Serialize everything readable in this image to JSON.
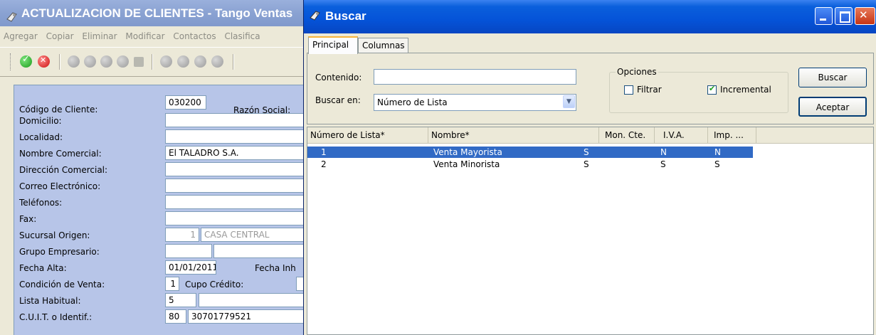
{
  "background_window": {
    "title": "ACTUALIZACION DE CLIENTES - Tango Ventas",
    "menu": [
      "Agregar",
      "Copiar",
      "Eliminar",
      "Modificar",
      "Contactos",
      "Clasifica"
    ],
    "fields": {
      "codigo_cliente": {
        "label": "Código de Cliente:",
        "value": "030200"
      },
      "razon_social": {
        "label": "Razón Social:"
      },
      "domicilio": {
        "label": "Domicilio:"
      },
      "localidad": {
        "label": "Localidad:"
      },
      "nombre_comercial": {
        "label": "Nombre Comercial:",
        "value": "El TALADRO S.A."
      },
      "direccion_comercial": {
        "label": "Dirección Comercial:"
      },
      "correo": {
        "label": "Correo Electrónico:"
      },
      "telefonos": {
        "label": "Teléfonos:"
      },
      "fax": {
        "label": "Fax:"
      },
      "sucursal_origen": {
        "label": "Sucursal Origen:",
        "code": "1",
        "name": "CASA CENTRAL"
      },
      "grupo_empresario": {
        "label": "Grupo Empresario:"
      },
      "fecha_alta": {
        "label": "Fecha Alta:",
        "value": "01/01/2011",
        "other_label": "Fecha Inh"
      },
      "condicion_venta": {
        "label": "Condición de Venta:",
        "value": "1",
        "cupo_label": "Cupo Crédito:"
      },
      "lista_habitual": {
        "label": "Lista Habitual:",
        "value": "5"
      },
      "cuit": {
        "label": "C.U.I.T. o Identif.:",
        "code": "80",
        "value": "30701779521"
      }
    }
  },
  "dialog": {
    "title": "Buscar",
    "tabs": [
      {
        "label": "Principal",
        "active": true
      },
      {
        "label": "Columnas",
        "active": false
      }
    ],
    "contenido_label": "Contenido:",
    "contenido_value": "",
    "buscar_en_label": "Buscar en:",
    "buscar_en_value": "Número de Lista",
    "opciones_label": "Opciones",
    "filtrar_label": "Filtrar",
    "filtrar_checked": false,
    "incremental_label": "Incremental",
    "incremental_checked": true,
    "buscar_button": "Buscar",
    "aceptar_button": "Aceptar",
    "grid": {
      "columns": [
        "Número de Lista*",
        "Nombre*",
        "Mon. Cte.",
        "I.V.A.",
        "Imp. ..."
      ],
      "rows": [
        {
          "numero": "1",
          "nombre": "Venta Mayorista",
          "mon_cte": "S",
          "iva": "N",
          "imp": "N",
          "selected": true
        },
        {
          "numero": "2",
          "nombre": "Venta Minorista",
          "mon_cte": "S",
          "iva": "S",
          "imp": "S",
          "selected": false
        }
      ]
    }
  },
  "colors": {
    "title_active": "#0553d8",
    "title_inactive": "#8aa2d2",
    "selection": "#316ac5",
    "form_panel": "#b7c5e8"
  }
}
